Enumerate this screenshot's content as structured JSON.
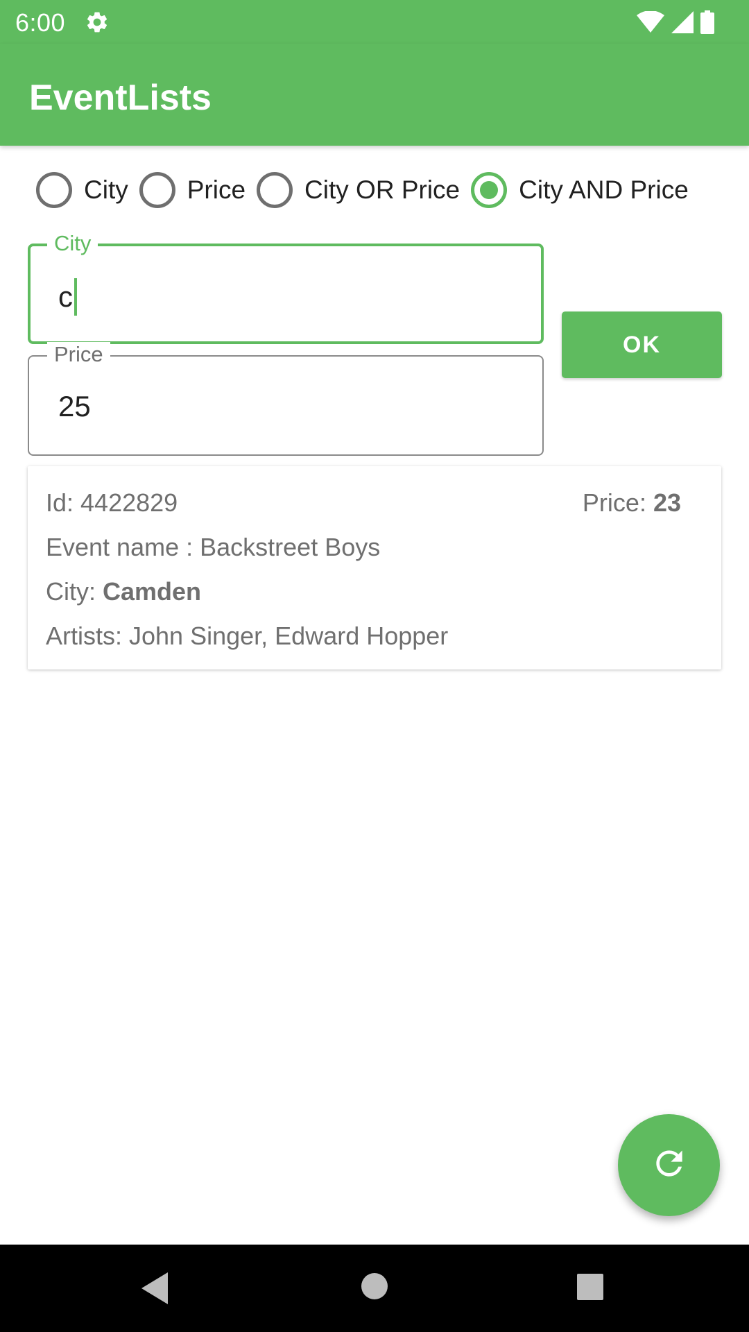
{
  "status_bar": {
    "time": "6:00",
    "icons": [
      "gear-icon",
      "wifi-icon",
      "signal-icon",
      "battery-icon"
    ]
  },
  "app_bar": {
    "title": "EventLists"
  },
  "filter": {
    "options": [
      {
        "label": "City",
        "checked": false
      },
      {
        "label": "Price",
        "checked": false
      },
      {
        "label": "City OR Price",
        "checked": false
      },
      {
        "label": "City AND Price",
        "checked": true
      }
    ]
  },
  "city_field": {
    "label": "City",
    "value": "c"
  },
  "price_field": {
    "label": "Price",
    "value": "25"
  },
  "ok_button": {
    "label": "OK"
  },
  "results": [
    {
      "id_label": "Id: ",
      "id": "4422829",
      "price_label": "Price: ",
      "price": "23",
      "name_label": "Event name : ",
      "name": "Backstreet Boys",
      "city_label": "City: ",
      "city": "Camden",
      "artists_label": "Artists: ",
      "artists": "John Singer, Edward Hopper"
    }
  ],
  "fab": {
    "icon": "refresh-icon"
  },
  "nav_bar": {
    "icons": [
      "back-icon",
      "home-icon",
      "recents-icon"
    ]
  },
  "colors": {
    "primary": "#5fbb5f",
    "text_secondary": "#6f6f6f",
    "nav_background": "#000000"
  }
}
